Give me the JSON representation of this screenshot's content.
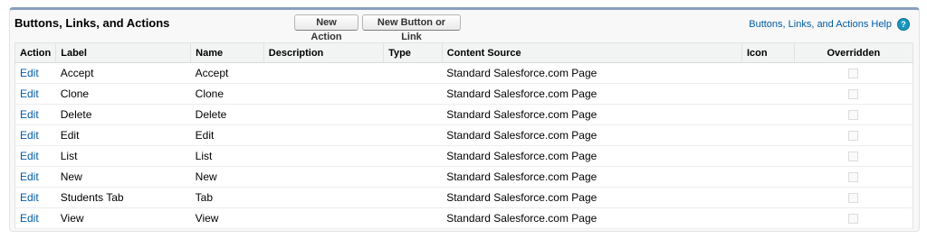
{
  "header": {
    "title": "Buttons, Links, and Actions",
    "new_action_label": "New Action",
    "new_link_label": "New Button or Link",
    "help_link": "Buttons, Links, and Actions Help",
    "help_icon": "?"
  },
  "table": {
    "columns": [
      "Action",
      "Label",
      "Name",
      "Description",
      "Type",
      "Content Source",
      "Icon",
      "Overridden"
    ],
    "rows": [
      {
        "action": "Edit",
        "label": "Accept",
        "name": "Accept",
        "description": "",
        "type": "",
        "source": "Standard Salesforce.com Page",
        "icon": "",
        "overridden": false
      },
      {
        "action": "Edit",
        "label": "Clone",
        "name": "Clone",
        "description": "",
        "type": "",
        "source": "Standard Salesforce.com Page",
        "icon": "",
        "overridden": false
      },
      {
        "action": "Edit",
        "label": "Delete",
        "name": "Delete",
        "description": "",
        "type": "",
        "source": "Standard Salesforce.com Page",
        "icon": "",
        "overridden": false
      },
      {
        "action": "Edit",
        "label": "Edit",
        "name": "Edit",
        "description": "",
        "type": "",
        "source": "Standard Salesforce.com Page",
        "icon": "",
        "overridden": false
      },
      {
        "action": "Edit",
        "label": "List",
        "name": "List",
        "description": "",
        "type": "",
        "source": "Standard Salesforce.com Page",
        "icon": "",
        "overridden": false
      },
      {
        "action": "Edit",
        "label": "New",
        "name": "New",
        "description": "",
        "type": "",
        "source": "Standard Salesforce.com Page",
        "icon": "",
        "overridden": false
      },
      {
        "action": "Edit",
        "label": "Students Tab",
        "name": "Tab",
        "description": "",
        "type": "",
        "source": "Standard Salesforce.com Page",
        "icon": "",
        "overridden": false
      },
      {
        "action": "Edit",
        "label": "View",
        "name": "View",
        "description": "",
        "type": "",
        "source": "Standard Salesforce.com Page",
        "icon": "",
        "overridden": false
      }
    ]
  },
  "colors": {
    "link": "#015ba7",
    "panel_top_border": "#8a9ebe",
    "help_icon": "#1797c0"
  }
}
